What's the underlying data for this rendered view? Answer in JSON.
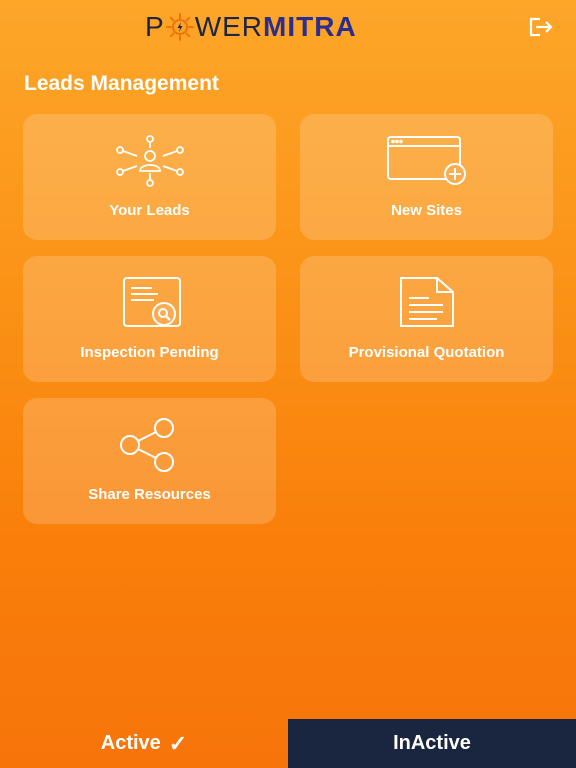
{
  "header": {
    "logo_part1_a": "P",
    "logo_part1_b": "WER",
    "logo_part2": "MITRA"
  },
  "section": {
    "title": "Leads Management"
  },
  "cards": [
    {
      "label": "Your Leads",
      "icon": "network-user-icon"
    },
    {
      "label": "New Sites",
      "icon": "browser-add-icon"
    },
    {
      "label": "Inspection Pending",
      "icon": "document-search-icon"
    },
    {
      "label": "Provisional Quotation",
      "icon": "document-icon"
    },
    {
      "label": "Share Resources",
      "icon": "share-icon"
    }
  ],
  "tabs": {
    "active_label": "Active",
    "active_mark": "✓",
    "inactive_label": "InActive"
  },
  "colors": {
    "background_top": "#fda629",
    "background_bottom": "#f7740a",
    "tab_inactive_bg": "#1a2540",
    "logo_dark": "#1c2541",
    "logo_blue": "#2b2d8f"
  }
}
